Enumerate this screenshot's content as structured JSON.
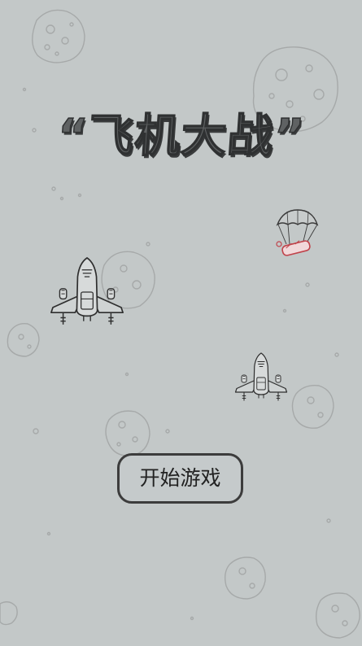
{
  "title": "“飞机大战”",
  "start_button": "开始游戏",
  "colors": {
    "background": "#c3c8c8",
    "sketch_line": "#3a3a3a",
    "asteroid_line": "#a8abab",
    "supply_accent": "#c0424a"
  }
}
